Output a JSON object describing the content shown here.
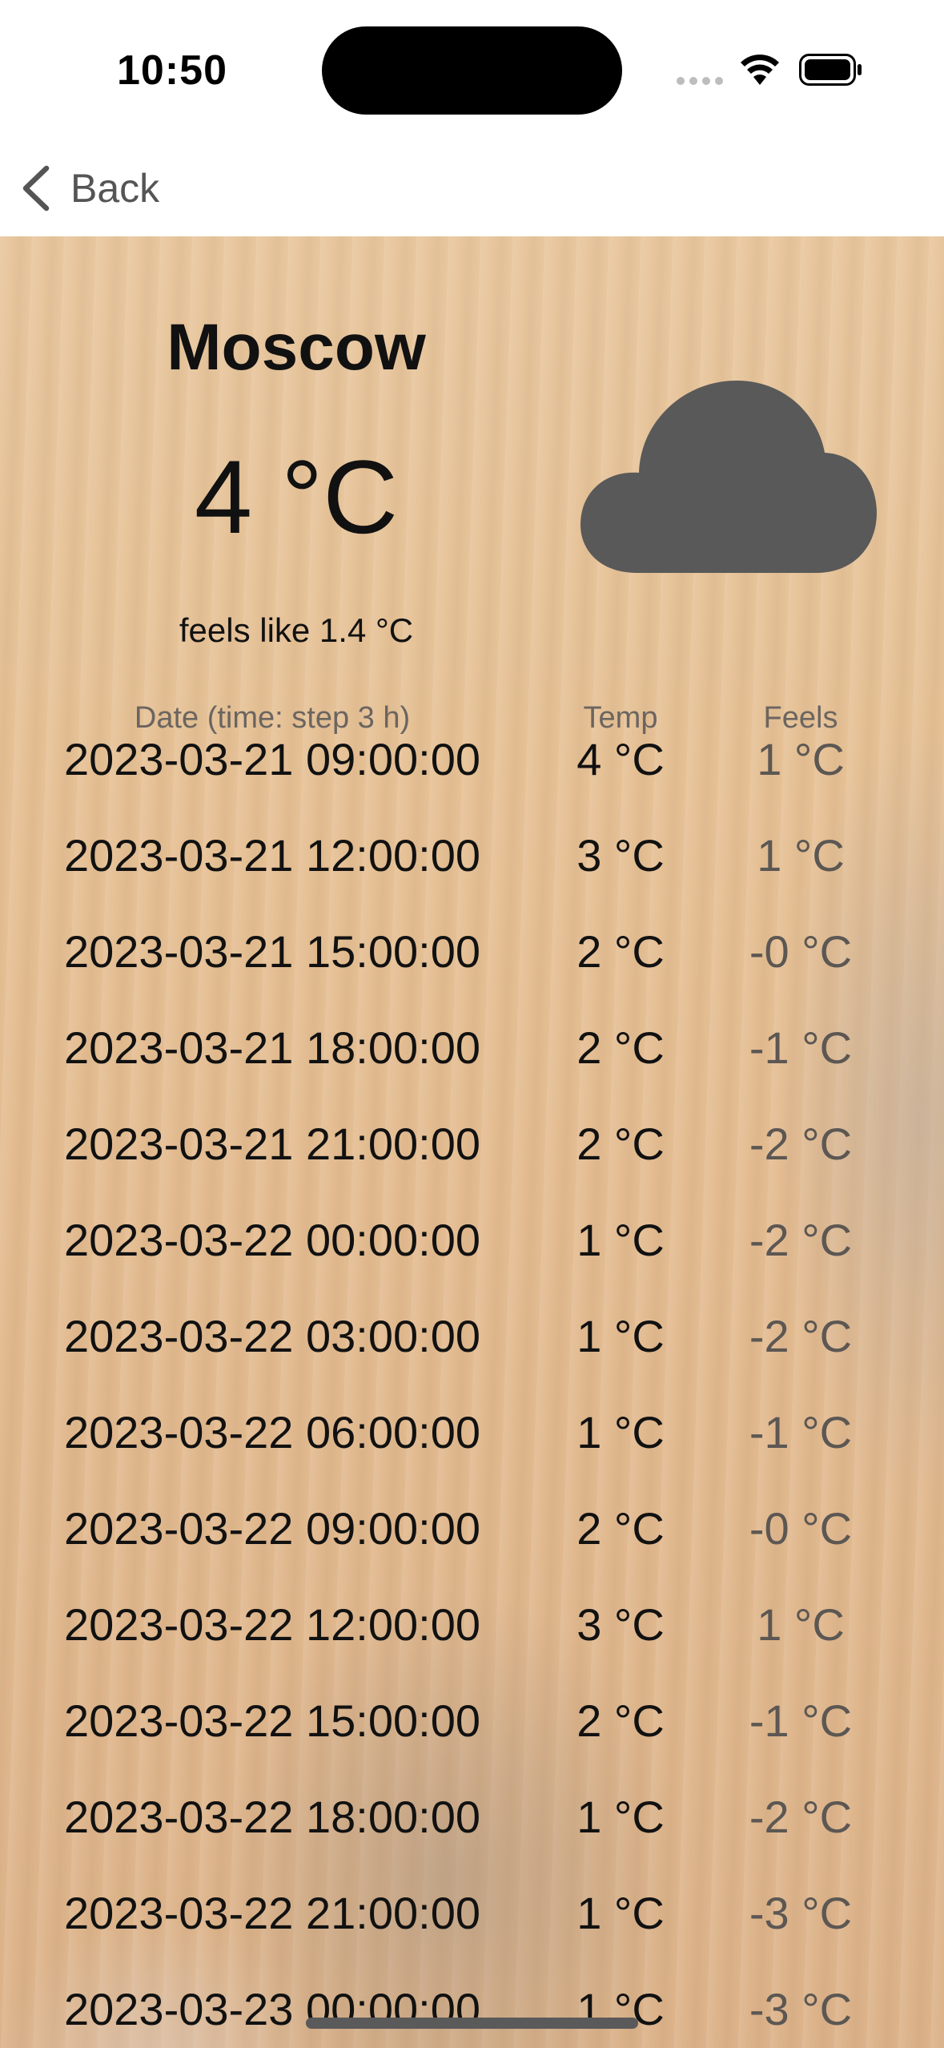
{
  "status_bar": {
    "time": "10:50",
    "icons": [
      "cellular-signal-icon",
      "wifi-icon",
      "battery-icon"
    ]
  },
  "nav": {
    "back_label": "Back",
    "back_icon": "chevron-left-icon"
  },
  "weather": {
    "city": "Moscow",
    "temperature": "4 °C",
    "feels_like": "feels like 1.4 °C",
    "condition_icon": "cloud-icon"
  },
  "table": {
    "headers": {
      "date": "Date (time: step 3 h)",
      "temp": "Temp",
      "feels": "Feels"
    },
    "rows": [
      {
        "date": "2023-03-21 09:00:00",
        "temp": "4 °C",
        "feels": "1 °C"
      },
      {
        "date": "2023-03-21 12:00:00",
        "temp": "3 °C",
        "feels": "1 °C"
      },
      {
        "date": "2023-03-21 15:00:00",
        "temp": "2 °C",
        "feels": "-0 °C"
      },
      {
        "date": "2023-03-21 18:00:00",
        "temp": "2 °C",
        "feels": "-1 °C"
      },
      {
        "date": "2023-03-21 21:00:00",
        "temp": "2 °C",
        "feels": "-2 °C"
      },
      {
        "date": "2023-03-22 00:00:00",
        "temp": "1 °C",
        "feels": "-2 °C"
      },
      {
        "date": "2023-03-22 03:00:00",
        "temp": "1 °C",
        "feels": "-2 °C"
      },
      {
        "date": "2023-03-22 06:00:00",
        "temp": "1 °C",
        "feels": "-1 °C"
      },
      {
        "date": "2023-03-22 09:00:00",
        "temp": "2 °C",
        "feels": "-0 °C"
      },
      {
        "date": "2023-03-22 12:00:00",
        "temp": "3 °C",
        "feels": "1 °C"
      },
      {
        "date": "2023-03-22 15:00:00",
        "temp": "2 °C",
        "feels": "-1 °C"
      },
      {
        "date": "2023-03-22 18:00:00",
        "temp": "1 °C",
        "feels": "-2 °C"
      },
      {
        "date": "2023-03-22 21:00:00",
        "temp": "1 °C",
        "feels": "-3 °C"
      },
      {
        "date": "2023-03-23 00:00:00",
        "temp": "1 °C",
        "feels": "-3 °C"
      }
    ]
  },
  "colors": {
    "accent_text": "#111111",
    "secondary_text": "#5c5753",
    "cloud": "#595959"
  }
}
